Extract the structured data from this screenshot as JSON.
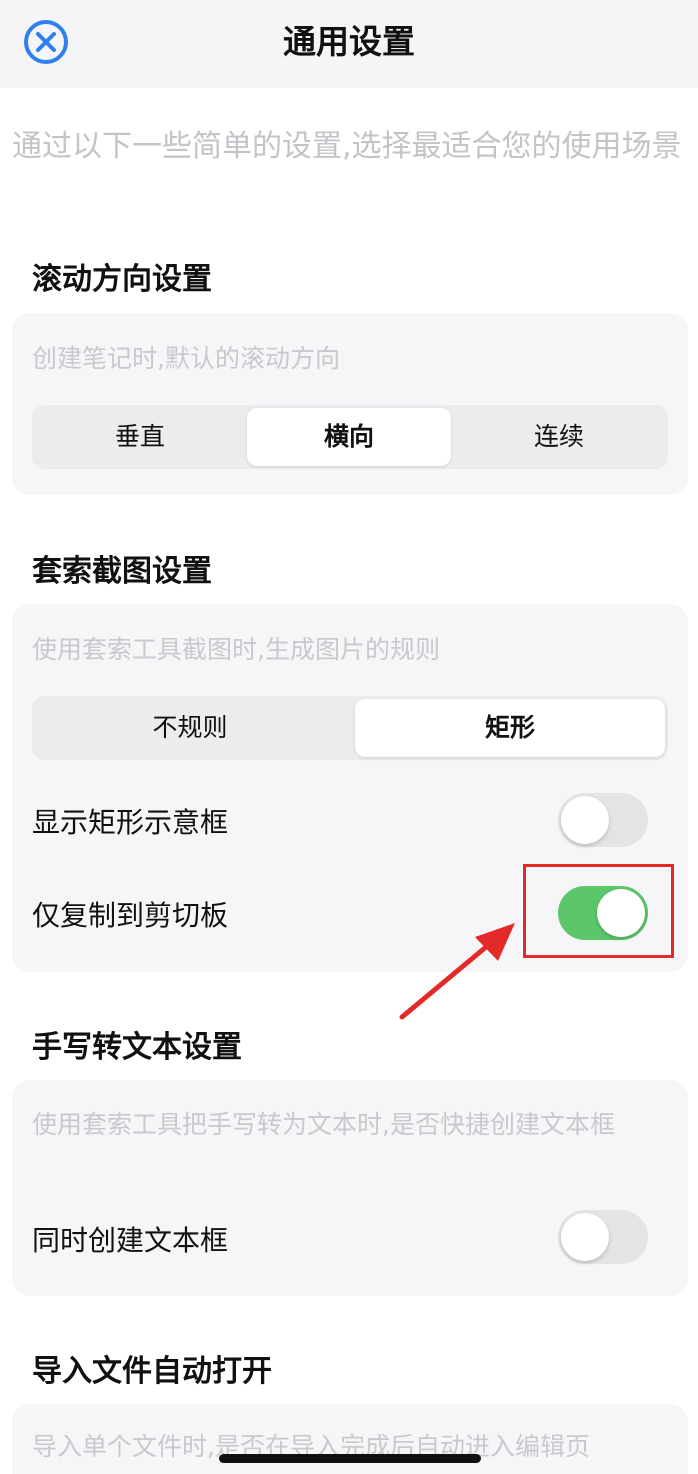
{
  "header": {
    "title": "通用设置",
    "close_icon": "close-circle-icon"
  },
  "intro": "通过以下一些简单的设置,选择最适合您的使用场景",
  "sections": {
    "scroll": {
      "title": "滚动方向设置",
      "description": "创建笔记时,默认的滚动方向",
      "options": [
        "垂直",
        "横向",
        "连续"
      ],
      "selected": "横向"
    },
    "lasso": {
      "title": "套索截图设置",
      "description": "使用套索工具截图时,生成图片的规则",
      "options": [
        "不规则",
        "矩形"
      ],
      "selected": "矩形",
      "toggles": [
        {
          "label": "显示矩形示意框",
          "on": false
        },
        {
          "label": "仅复制到剪切板",
          "on": true
        }
      ]
    },
    "handwriting": {
      "title": "手写转文本设置",
      "description": "使用套索工具把手写转为文本时,是否快捷创建文本框",
      "toggles": [
        {
          "label": "同时创建文本框",
          "on": false
        }
      ]
    },
    "import": {
      "title": "导入文件自动打开",
      "description": "导入单个文件时,是否在导入完成后自动进入编辑页"
    }
  },
  "annotation": {
    "color": "#e42929"
  },
  "colors": {
    "accent": "#2f7ff0",
    "toggle_on": "#5bc76a"
  }
}
